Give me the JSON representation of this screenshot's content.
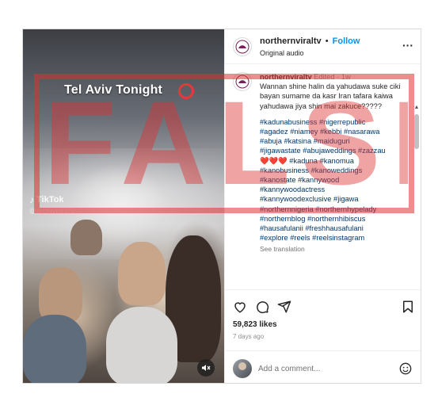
{
  "media": {
    "overlay_title": "Tel Aviv Tonight",
    "watermark_brand": "TikTok",
    "watermark_user": "@archived372"
  },
  "stamp": {
    "text": "FALSE",
    "color": "#dc3232"
  },
  "header": {
    "username": "northernviraltv",
    "separator": "•",
    "follow_label": "Follow",
    "audio_label": "Original audio",
    "more_label": "···"
  },
  "caption": {
    "username": "northernviraltv",
    "meta": "Edited · 1w",
    "text": "Wannan shine halin da yahudawa suke ciki bayan sumame da kasr Iran tafara kaiwa yahudawa jiya shin mai zakuce?????",
    "hashtags": [
      "#kadunabusiness #nigerrepublic",
      "#agadez #niamey #kebbi #nasarawa",
      "#abuja #katsina #maiduguri",
      "#jigawastate #abujaweddings #zazzau",
      "❤️❤️❤️ #kaduna #kanomua",
      "#kanobusiness #kanoweddings",
      "#kanostate #kannywood",
      "#kannywoodactress",
      "#kannywoodexclusive #jigawa",
      "#northernnigeria #northernhypelady",
      "#northernblog #northernhibiscus",
      "#hausafulanii #freshhausafulani",
      "#explore #reels #reelsinstagram"
    ],
    "see_translation": "See translation"
  },
  "actions": {
    "like_icon": "heart-icon",
    "comment_icon": "comment-icon",
    "share_icon": "share-icon",
    "save_icon": "bookmark-icon",
    "likes": "59,823 likes",
    "ago": "7 days ago"
  },
  "comment": {
    "placeholder": "Add a comment...",
    "emoji_icon": "emoji-icon"
  },
  "colors": {
    "link": "#0095f6",
    "hashtag": "#00376b",
    "stamp_red": "#dc3232"
  }
}
